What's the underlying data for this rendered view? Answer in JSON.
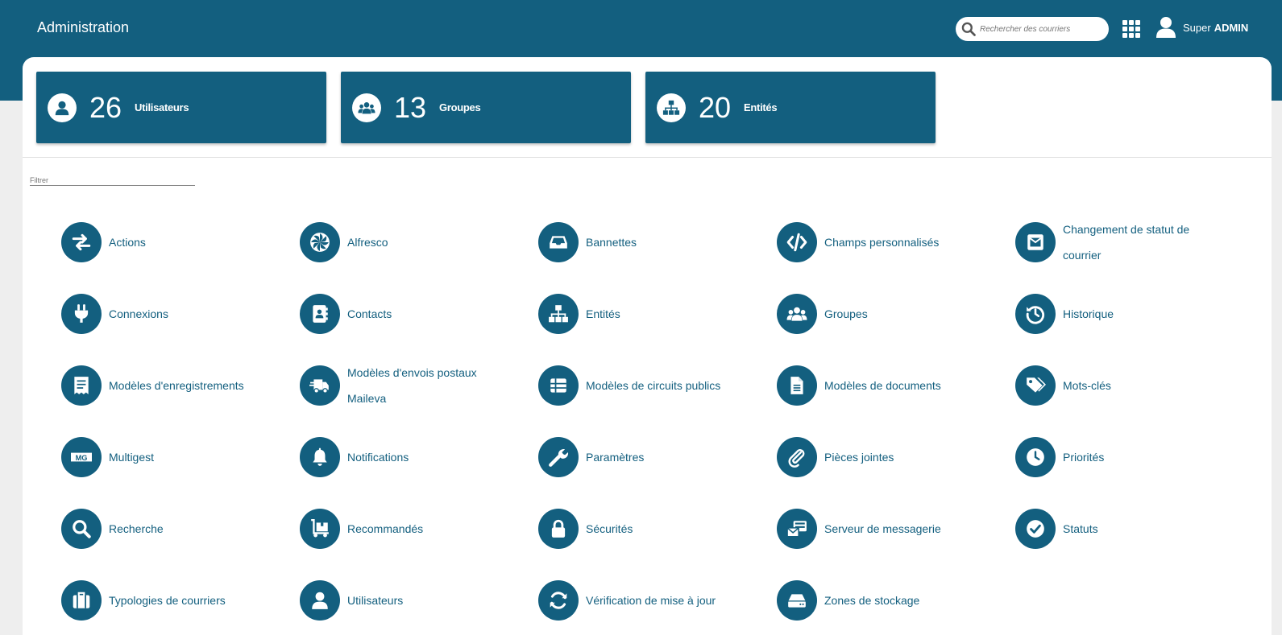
{
  "header": {
    "title": "Administration",
    "search_placeholder": "Rechercher des courriers",
    "user_first": "Super",
    "user_last": "ADMIN"
  },
  "stats": [
    {
      "count": "26",
      "label": "Utilisateurs",
      "icon": "user-icon"
    },
    {
      "count": "13",
      "label": "Groupes",
      "icon": "users-icon"
    },
    {
      "count": "20",
      "label": "Entités",
      "icon": "sitemap-icon"
    }
  ],
  "filter_placeholder": "Filtrer",
  "accent_color": "#135f7f",
  "admin_items": [
    {
      "label": "Actions",
      "icon": "exchange-icon"
    },
    {
      "label": "Alfresco",
      "icon": "alfresco-icon"
    },
    {
      "label": "Bannettes",
      "icon": "inbox-icon"
    },
    {
      "label": "Champs personnalisés",
      "icon": "code-icon"
    },
    {
      "label": "Changement de statut de courrier",
      "icon": "envelope-square-icon"
    },
    {
      "label": "Connexions",
      "icon": "plug-icon"
    },
    {
      "label": "Contacts",
      "icon": "address-book-icon"
    },
    {
      "label": "Entités",
      "icon": "sitemap-icon"
    },
    {
      "label": "Groupes",
      "icon": "users-icon"
    },
    {
      "label": "Historique",
      "icon": "history-icon"
    },
    {
      "label": "Modèles d'enregistrements",
      "icon": "receipt-icon"
    },
    {
      "label": "Modèles d'envois postaux Maileva",
      "icon": "shipping-fast-icon"
    },
    {
      "label": "Modèles de circuits publics",
      "icon": "table-list-icon"
    },
    {
      "label": "Modèles de documents",
      "icon": "file-alt-icon"
    },
    {
      "label": "Mots-clés",
      "icon": "tags-icon"
    },
    {
      "label": "Multigest",
      "icon": "multigest-icon"
    },
    {
      "label": "Notifications",
      "icon": "bell-icon"
    },
    {
      "label": "Paramètres",
      "icon": "wrench-icon"
    },
    {
      "label": "Pièces jointes",
      "icon": "paperclip-icon"
    },
    {
      "label": "Priorités",
      "icon": "clock-icon"
    },
    {
      "label": "Recherche",
      "icon": "search-icon"
    },
    {
      "label": "Recommandés",
      "icon": "dolly-icon"
    },
    {
      "label": "Sécurités",
      "icon": "lock-icon"
    },
    {
      "label": "Serveur de messagerie",
      "icon": "mail-server-icon"
    },
    {
      "label": "Statuts",
      "icon": "check-circle-icon"
    },
    {
      "label": "Typologies de courriers",
      "icon": "suitcase-icon"
    },
    {
      "label": "Utilisateurs",
      "icon": "user-icon"
    },
    {
      "label": "Vérification de mise à jour",
      "icon": "sync-icon"
    },
    {
      "label": "Zones de stockage",
      "icon": "hdd-icon"
    }
  ]
}
